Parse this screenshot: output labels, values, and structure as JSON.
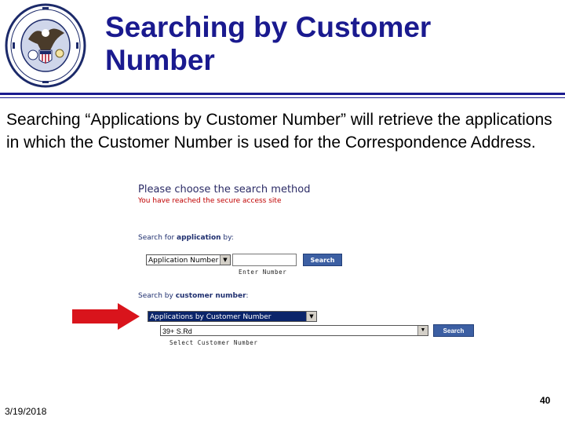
{
  "slide": {
    "title": "Searching by Customer\nNumber",
    "body": "Searching “Applications by Customer Number” will retrieve the applications in which the Customer Number is used for the Correspondence Address.",
    "date": "3/19/2018",
    "page_number": "40",
    "seal_icon": "uspto-seal-icon"
  },
  "screenshot": {
    "heading": "Please choose the search method",
    "notice": "You have reached the secure access site",
    "application_section": {
      "label_prefix": "Search for ",
      "label_bold": "application",
      "label_suffix": " by:",
      "select_value": "Application Number",
      "input_value": "",
      "button_label": "Search",
      "caption": "Enter Number"
    },
    "customer_section": {
      "label_prefix": "Search by ",
      "label_bold": "customer number",
      "label_suffix": ":",
      "select_value": "Applications by Customer Number",
      "customer_select_value": "39+ S.Rd",
      "button_label": "Search",
      "caption": "Select Customer Number"
    }
  },
  "colors": {
    "title": "#1a1a8f",
    "arrow": "#d9141c",
    "button": "#3c5fa3",
    "notice": "#c00000"
  }
}
